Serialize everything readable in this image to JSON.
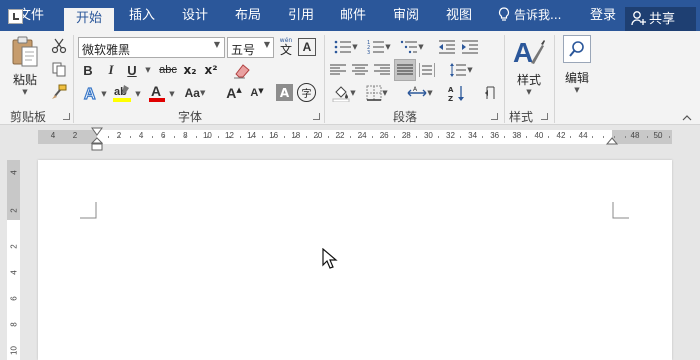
{
  "tabs": [
    {
      "label": "文件",
      "active": false
    },
    {
      "label": "开始",
      "active": true
    },
    {
      "label": "插入",
      "active": false
    },
    {
      "label": "设计",
      "active": false
    },
    {
      "label": "布局",
      "active": false
    },
    {
      "label": "引用",
      "active": false
    },
    {
      "label": "邮件",
      "active": false
    },
    {
      "label": "审阅",
      "active": false
    },
    {
      "label": "视图",
      "active": false
    }
  ],
  "tell_me": {
    "placeholder": "告诉我...",
    "icon": "lightbulb-icon"
  },
  "account": {
    "login": "登录",
    "share": "共享"
  },
  "clipboard": {
    "paste_label": "粘贴",
    "group_label": "剪贴板"
  },
  "font": {
    "name": "微软雅黑",
    "size": "五号",
    "wen_glyph": "wén",
    "wen_char": "文",
    "box_a": "A",
    "bold": "B",
    "italic": "I",
    "underline": "U",
    "strike": "abc",
    "subscript": "x₂",
    "superscript": "x²",
    "grow": "A",
    "shrink": "A",
    "char_shading": "A",
    "enclose": "字",
    "group_label": "字体",
    "highlight_color": "#ffff00",
    "font_color": "#e00000"
  },
  "paragraph": {
    "group_label": "段落"
  },
  "styles": {
    "button_label": "样式",
    "group_label": "样式"
  },
  "editing": {
    "button_label": "编辑"
  },
  "ruler": {
    "h_labels": [
      "4",
      "2",
      "2",
      "4",
      "6",
      "8",
      "10",
      "12",
      "14",
      "16",
      "18",
      "20",
      "22",
      "24",
      "26",
      "28",
      "30",
      "32",
      "34",
      "36",
      "38",
      "40",
      "42",
      "44",
      "48",
      "50"
    ],
    "v_labels": [
      "4",
      "2",
      "2",
      "4",
      "6",
      "8",
      "10"
    ]
  },
  "colors": {
    "brand": "#2b579a",
    "share_bg": "#1e3f72",
    "ribbon_bg": "#f3f3f3"
  }
}
